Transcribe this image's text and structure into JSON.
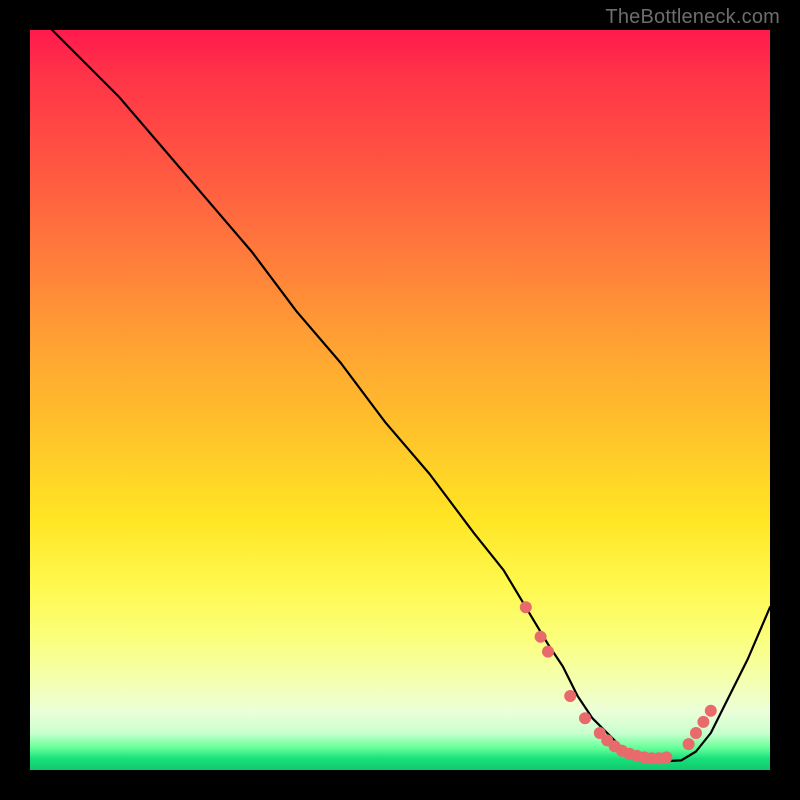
{
  "watermark": "TheBottleneck.com",
  "colors": {
    "curve_stroke": "#000000",
    "marker_fill": "#e86a6a",
    "frame_bg": "#000000"
  },
  "chart_data": {
    "type": "line",
    "title": "",
    "xlabel": "",
    "ylabel": "",
    "xlim": [
      0,
      100
    ],
    "ylim": [
      0,
      100
    ],
    "grid": false,
    "series": [
      {
        "name": "bottleneck-curve",
        "x": [
          3,
          5,
          8,
          12,
          18,
          24,
          30,
          36,
          42,
          48,
          54,
          60,
          64,
          67,
          70,
          72,
          74,
          76,
          78,
          80,
          82,
          84,
          86,
          88,
          90,
          92,
          94,
          97,
          100
        ],
        "y": [
          100,
          98,
          95,
          91,
          84,
          77,
          70,
          62,
          55,
          47,
          40,
          32,
          27,
          22,
          17,
          14,
          10,
          7,
          5,
          3,
          2,
          1.5,
          1.2,
          1.3,
          2.5,
          5,
          9,
          15,
          22
        ]
      }
    ],
    "markers": {
      "name": "highlighted-points",
      "x": [
        67,
        69,
        70,
        73,
        75,
        77,
        78,
        79,
        80,
        81,
        82,
        83,
        84,
        85,
        86,
        89,
        90,
        91,
        92
      ],
      "y": [
        22,
        18,
        16,
        10,
        7,
        5,
        4,
        3.2,
        2.6,
        2.2,
        1.9,
        1.7,
        1.6,
        1.6,
        1.7,
        3.5,
        5,
        6.5,
        8
      ]
    }
  }
}
